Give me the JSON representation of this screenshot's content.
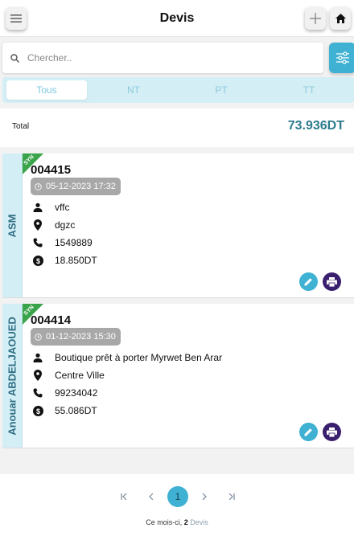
{
  "header": {
    "title": "Devis",
    "menu_icon": "menu-icon",
    "add_icon": "plus-icon",
    "home_icon": "home-icon"
  },
  "search": {
    "placeholder": "Chercher.."
  },
  "tabs": [
    {
      "label": "Tous",
      "active": true
    },
    {
      "label": "NT",
      "active": false
    },
    {
      "label": "PT",
      "active": false
    },
    {
      "label": "TT",
      "active": false
    }
  ],
  "total": {
    "label": "Total",
    "value": "73.936DT"
  },
  "devis": [
    {
      "side_label": "ASM",
      "sync_badge": "SYN",
      "code": "004415",
      "date": "05-12-2023 17:32",
      "client": "vffc",
      "address": "dgzc",
      "phone": "1549889",
      "amount": "18.850DT"
    },
    {
      "side_label": "Anouar ABDELJAOUED",
      "sync_badge": "SYN",
      "code": "004414",
      "date": "01-12-2023 15:30",
      "client": "Boutique prêt à porter Myrwet Ben Arar",
      "address": "Centre Ville",
      "phone": "99234042",
      "amount": "55.086DT"
    }
  ],
  "pagination": {
    "current": "1"
  },
  "footer": {
    "prefix": "Ce mois-ci, ",
    "count": "2",
    "suffix": " Devis"
  },
  "colors": {
    "accent": "#3fb1d3",
    "side": "#d4eef6",
    "print": "#3a1f6e",
    "sync": "#3aa44a",
    "total": "#2e7c8e"
  }
}
